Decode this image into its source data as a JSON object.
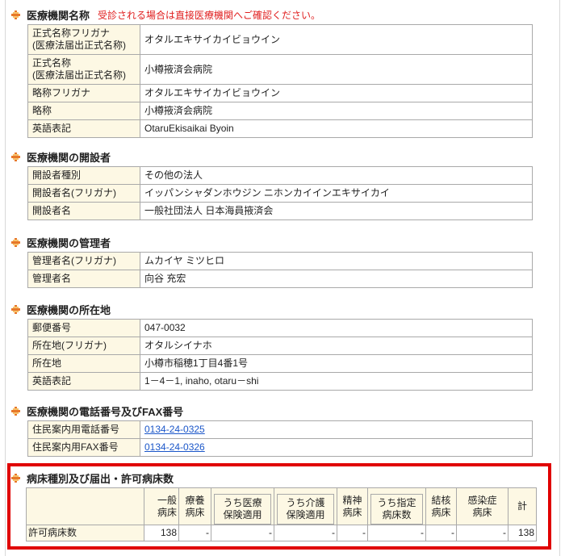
{
  "name_section": {
    "title": "医療機関名称",
    "note": "受診される場合は直接医療機関へご確認ください。",
    "rows": [
      {
        "label": "正式名称フリガナ\n(医療法届出正式名称)",
        "value": "オタルエキサイカイビョウイン"
      },
      {
        "label": "正式名称\n(医療法届出正式名称)",
        "value": "小樽掖済会病院"
      },
      {
        "label": "略称フリガナ",
        "value": "オタルエキサイカイビョウイン"
      },
      {
        "label": "略称",
        "value": "小樽掖済会病院"
      },
      {
        "label": "英語表記",
        "value": "OtaruEkisaikai Byoin"
      }
    ]
  },
  "founder_section": {
    "title": "医療機関の開設者",
    "rows": [
      {
        "label": "開設者種別",
        "value": "その他の法人"
      },
      {
        "label": "開設者名(フリガナ)",
        "value": "イッパンシャダンホウジン ニホンカイインエキサイカイ"
      },
      {
        "label": "開設者名",
        "value": "一般社団法人 日本海員掖済会"
      }
    ]
  },
  "manager_section": {
    "title": "医療機関の管理者",
    "rows": [
      {
        "label": "管理者名(フリガナ)",
        "value": "ムカイヤ ミツヒロ"
      },
      {
        "label": "管理者名",
        "value": "向谷 充宏"
      }
    ]
  },
  "location_section": {
    "title": "医療機関の所在地",
    "rows": [
      {
        "label": "郵便番号",
        "value": "047-0032"
      },
      {
        "label": "所在地(フリガナ)",
        "value": "オタルシイナホ"
      },
      {
        "label": "所在地",
        "value": "小樽市稲穂1丁目4番1号"
      },
      {
        "label": "英語表記",
        "value": "1－4－1, inaho, otaru－shi"
      }
    ]
  },
  "phone_section": {
    "title": "医療機関の電話番号及びFAX番号",
    "rows": [
      {
        "label": "住民案内用電話番号",
        "value": "0134-24-0325"
      },
      {
        "label": "住民案内用FAX番号",
        "value": "0134-24-0326"
      }
    ]
  },
  "beds_section": {
    "title": "病床種別及び届出・許可病床数",
    "headers": {
      "general": "一般\n病床",
      "recuperation": "療養\n病床",
      "medical_insurance": "うち医療\n保険適用",
      "care_insurance": "うち介護\n保険適用",
      "psychiatric": "精神\n病床",
      "designated": "うち指定\n病床数",
      "tuberculosis": "結核\n病床",
      "infectious": "感染症\n病床",
      "total": "計"
    },
    "row_label": "許可病床数",
    "values": {
      "general": "138",
      "recuperation": "-",
      "medical_insurance": "-",
      "care_insurance": "-",
      "psychiatric": "-",
      "designated": "-",
      "tuberculosis": "-",
      "infectious": "-",
      "total": "138"
    }
  }
}
